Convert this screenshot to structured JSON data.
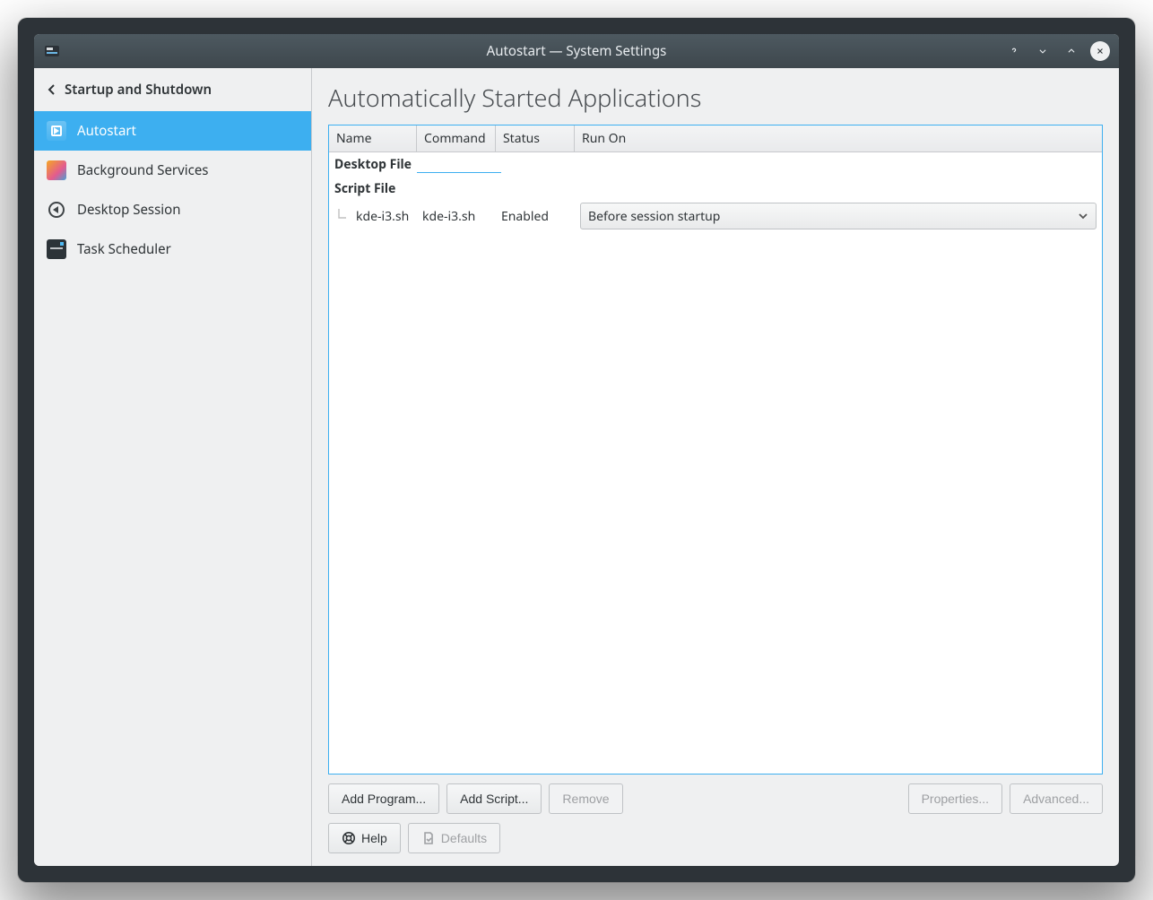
{
  "window": {
    "title": "Autostart — System Settings"
  },
  "sidebar": {
    "crumb": "Startup and Shutdown",
    "items": [
      {
        "id": "autostart",
        "label": "Autostart",
        "icon": "autostart-icon",
        "active": true
      },
      {
        "id": "bg",
        "label": "Background Services",
        "icon": "background-svc-icon",
        "active": false
      },
      {
        "id": "desktop",
        "label": "Desktop Session",
        "icon": "desktop-session-icon",
        "active": false
      },
      {
        "id": "task",
        "label": "Task Scheduler",
        "icon": "task-scheduler-icon",
        "active": false
      }
    ]
  },
  "page": {
    "title": "Automatically Started Applications"
  },
  "table": {
    "headers": {
      "name": "Name",
      "command": "Command",
      "status": "Status",
      "run_on": "Run On"
    },
    "groups": [
      {
        "label": "Desktop File",
        "rows": []
      },
      {
        "label": "Script File",
        "rows": [
          {
            "name": "kde-i3.sh",
            "command": "kde-i3.sh",
            "status": "Enabled",
            "run_on": "Before session startup"
          }
        ]
      }
    ]
  },
  "buttons": {
    "add_program": "Add Program...",
    "add_script": "Add Script...",
    "remove": "Remove",
    "properties": "Properties...",
    "advanced": "Advanced...",
    "help": "Help",
    "defaults": "Defaults"
  }
}
